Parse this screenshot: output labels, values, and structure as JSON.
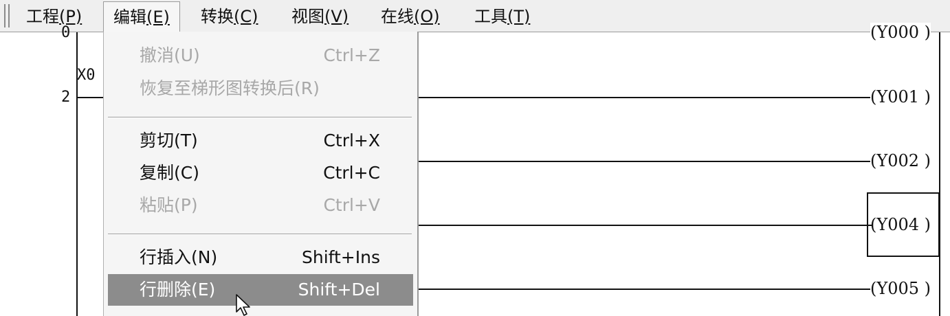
{
  "menubar": {
    "items": [
      {
        "text": "工程",
        "key": "(P)"
      },
      {
        "text": "编辑",
        "key": "(E)"
      },
      {
        "text": "转换",
        "key": "(C)"
      },
      {
        "text": "视图",
        "key": "(V)"
      },
      {
        "text": "在线",
        "key": "(O)"
      },
      {
        "text": "工具",
        "key": "(T)"
      }
    ]
  },
  "edit_menu": {
    "items": [
      {
        "label": "撤消(U)",
        "shortcut": "Ctrl+Z",
        "enabled": false
      },
      {
        "label": "恢复至梯形图转换后(R)",
        "shortcut": "",
        "enabled": false
      },
      {
        "label": "剪切(T)",
        "shortcut": "Ctrl+X",
        "enabled": true
      },
      {
        "label": "复制(C)",
        "shortcut": "Ctrl+C",
        "enabled": true
      },
      {
        "label": "粘贴(P)",
        "shortcut": "Ctrl+V",
        "enabled": false
      },
      {
        "label": "行插入(N)",
        "shortcut": "Shift+Ins",
        "enabled": true
      },
      {
        "label": "行删除(E)",
        "shortcut": "Shift+Del",
        "enabled": true,
        "highlighted": true
      }
    ]
  },
  "ladder": {
    "step_numbers": [
      "0",
      "2"
    ],
    "contact_label": "X0",
    "coils": [
      "(Y000 )",
      "(Y001 )",
      "(Y002 )",
      "(Y004 )",
      "(Y005 )"
    ]
  },
  "colors": {
    "menu_bg": "#efefef",
    "dropdown_bg": "#f5f5f5",
    "highlight_bg": "#8c8c8c",
    "disabled_text": "#a8a8a8"
  }
}
